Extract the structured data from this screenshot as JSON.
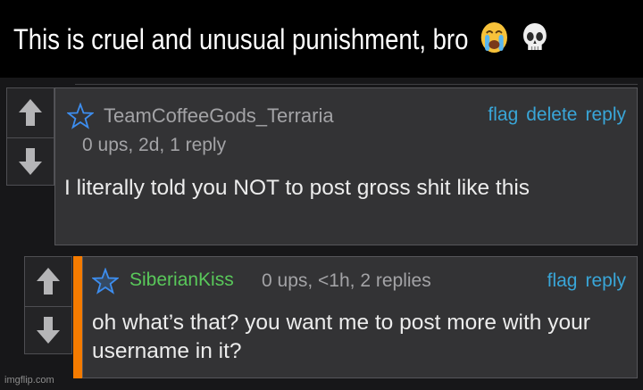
{
  "caption": {
    "text": "This is cruel and unusual punishment, bro",
    "emojis": [
      "crying-face-emoji",
      "skull-emoji"
    ]
  },
  "comments": [
    {
      "username": "TeamCoffeeGods_Terraria",
      "meta": "0 ups, 2d, 1 reply",
      "actions": [
        "flag",
        "delete",
        "reply"
      ],
      "body": "I literally told you NOT to post gross shit like this"
    },
    {
      "username": "SiberianKiss",
      "meta": "0 ups, <1h, 2 replies",
      "actions": [
        "flag",
        "reply"
      ],
      "body": "oh what’s that? you want me to post more with your username in it?"
    }
  ],
  "colors": {
    "link": "#39a6d8",
    "reply_username": "#59c85a",
    "accent": "#f57b00"
  },
  "watermark": "imgflip.com"
}
